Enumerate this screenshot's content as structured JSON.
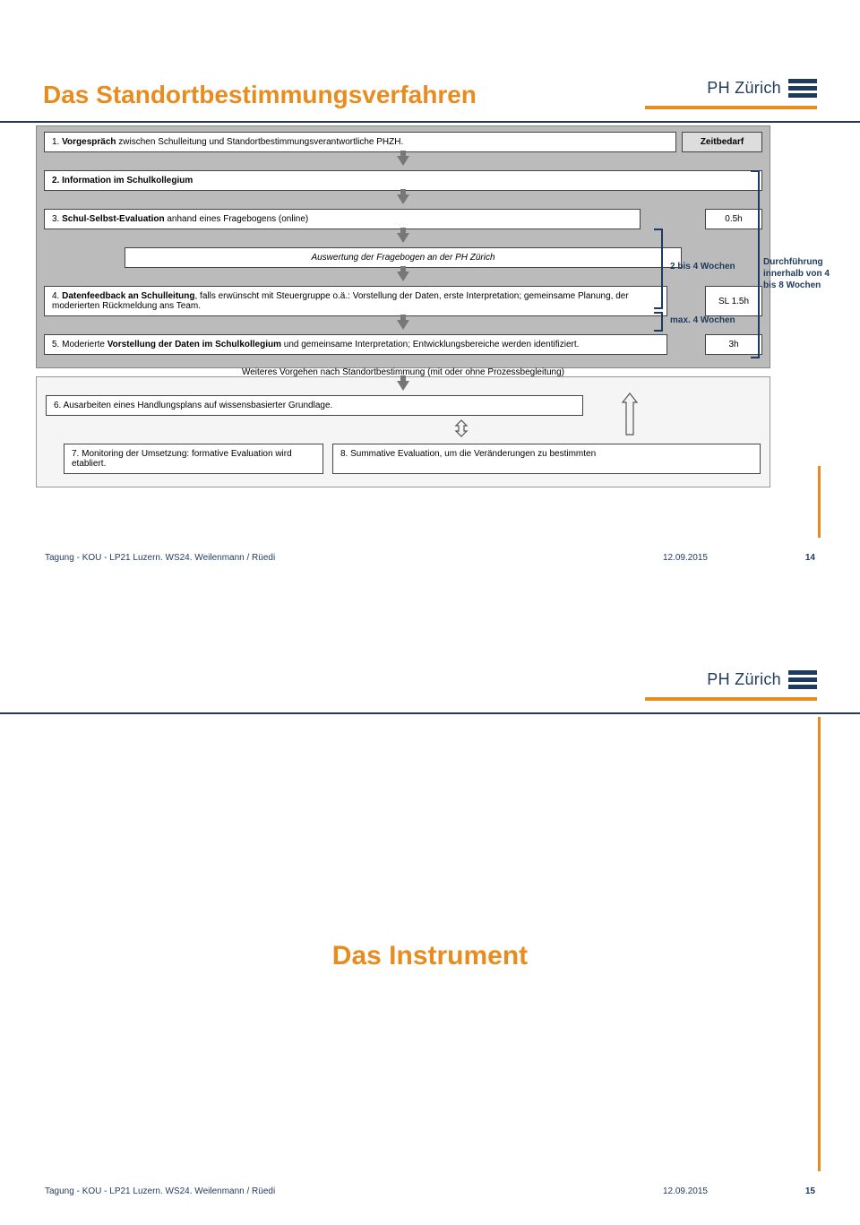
{
  "slide1": {
    "title": "Das Standortbestimmungsverfahren",
    "logo_text": "PH Zürich",
    "timehead": "Zeitbedarf",
    "step1_pre": "1.  ",
    "step1_bold": "Vorgespräch",
    "step1_post": " zwischen Schulleitung und Standortbestimmungsverantwortliche PHZH.",
    "step2": "2.  Information im Schulkollegium",
    "step3_pre": "3.  ",
    "step3_bold": "Schul-Selbst-Evaluation",
    "step3_post": " anhand eines Fragebogens (online)",
    "step3_time": "0.5h",
    "auswertung": "Auswertung der Fragebogen an der PH Zürich",
    "step4_pre": "4.  ",
    "step4_bold": "Datenfeedback an Schulleitung",
    "step4_post": ", falls erwünscht mit Steuergruppe o.ä.: Vorstellung der Daten, erste Interpretation; gemeinsame Planung, der moderierten Rückmeldung ans Team.",
    "step4_time": "SL 1.5h",
    "step5_pre": "5.  Moderierte ",
    "step5_bold": "Vorstellung der Daten im Schulkollegium",
    "step5_post": " und gemeinsame Interpretation; Entwicklungsbereiche werden identifiziert.",
    "step5_time": "3h",
    "weiter": "Weiteres Vorgehen nach Standortbestimmung (mit oder ohne Prozessbegleitung)",
    "step6": "6.  Ausarbeiten eines Handlungsplans auf wissensbasierter Grundlage.",
    "step7": "7.  Monitoring der Umsetzung: formative Evaluation wird etabliert.",
    "step8": "8. Summative Evaluation, um die Veränderungen zu bestimmten",
    "bracket1": "2 bis 4 Wochen",
    "bracket2": "max. 4 Wochen",
    "side": "Durchführung innerhalb von 4 bis 8 Wochen",
    "footer_left": "Tagung - KOU - LP21 Luzern. WS24. Weilenmann / Rüedi",
    "footer_date": "12.09.2015",
    "footer_page": "14"
  },
  "slide2": {
    "logo_text": "PH Zürich",
    "title": "Das Instrument",
    "footer_left": "Tagung - KOU - LP21 Luzern. WS24. Weilenmann / Rüedi",
    "footer_date": "12.09.2015",
    "footer_page": "15"
  }
}
